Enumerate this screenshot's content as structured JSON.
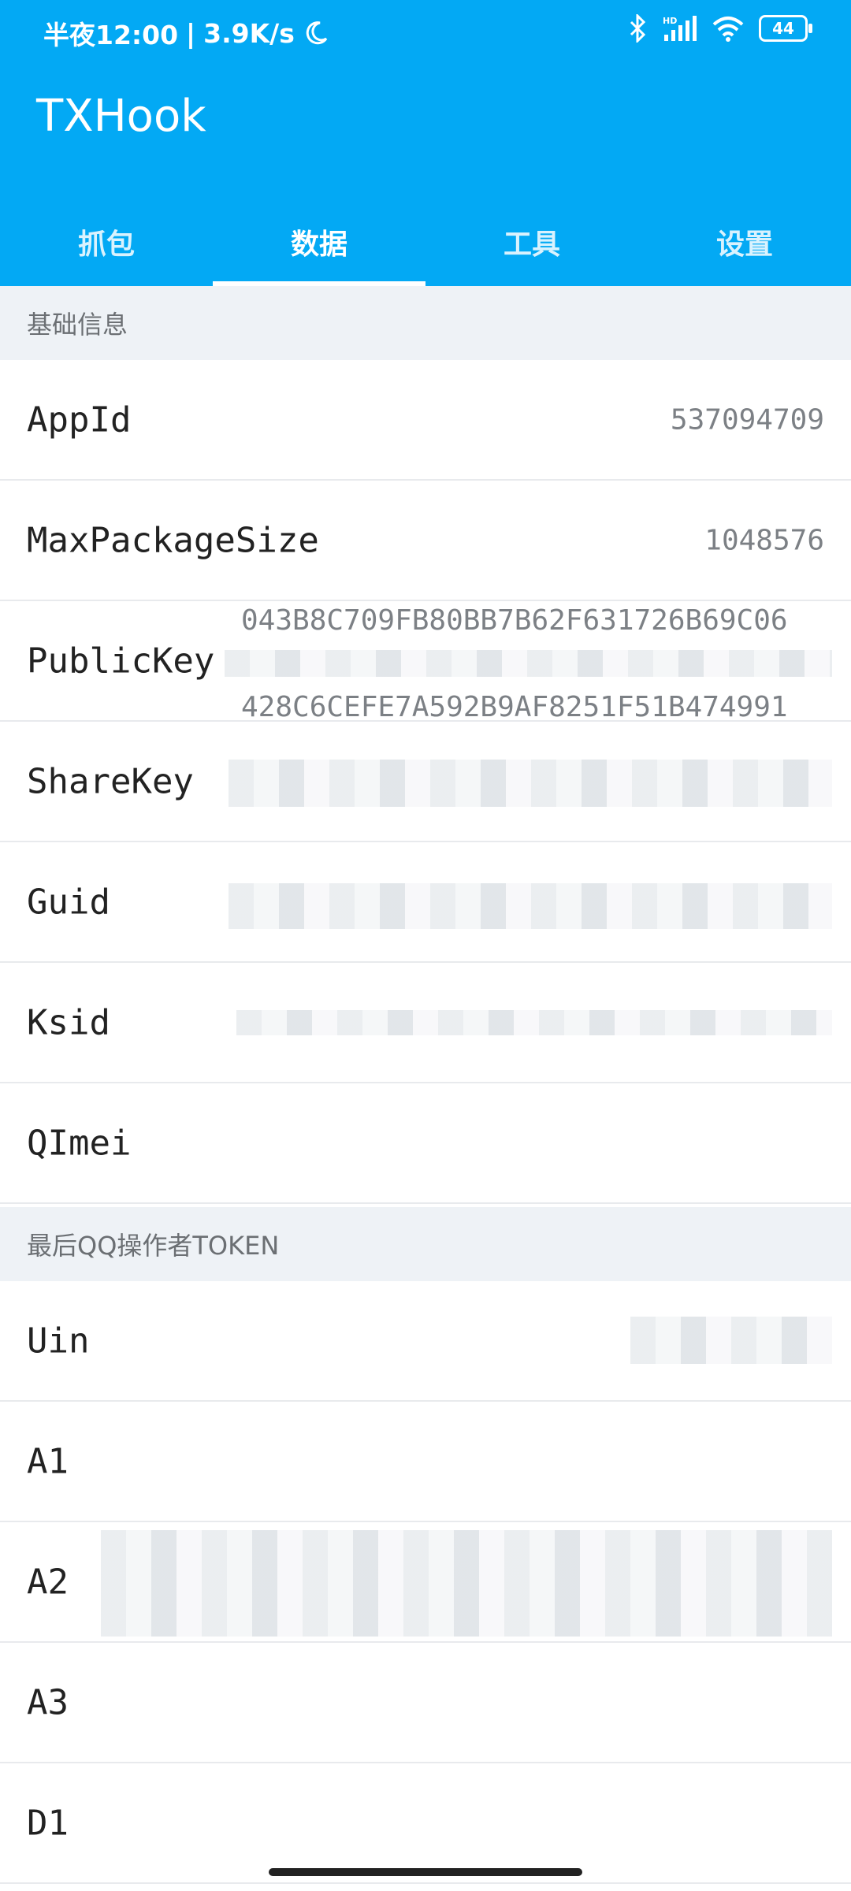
{
  "status_bar": {
    "time": "半夜12:00",
    "speed": "3.9K/s",
    "battery": "44",
    "icons": [
      "moon-icon",
      "bluetooth-icon",
      "signal-icon",
      "wifi-icon",
      "battery-icon"
    ],
    "hd_label": "HD"
  },
  "app": {
    "title": "TXHook"
  },
  "tabs": [
    {
      "label": "抓包"
    },
    {
      "label": "数据",
      "active": true
    },
    {
      "label": "工具"
    },
    {
      "label": "设置"
    }
  ],
  "sections": {
    "basic": "基础信息",
    "token": "最后QQ操作者TOKEN"
  },
  "rows": {
    "appid": {
      "label": "AppId",
      "value": "537094709"
    },
    "maxpackage": {
      "label": "MaxPackageSize",
      "value": "1048576"
    },
    "publickey": {
      "label": "PublicKey",
      "line1": "043B8C709FB80BB7B62F631726B69C06",
      "line3": "428C6CEFE7A592B9AF8251F51B474991"
    },
    "sharekey": {
      "label": "ShareKey"
    },
    "guid": {
      "label": "Guid"
    },
    "ksid": {
      "label": "Ksid"
    },
    "qimei": {
      "label": "QImei"
    },
    "uin": {
      "label": "Uin"
    },
    "a1": {
      "label": "A1"
    },
    "a2": {
      "label": "A2"
    },
    "a3": {
      "label": "A3"
    },
    "d1": {
      "label": "D1"
    }
  },
  "colors": {
    "accent": "#03a9f4",
    "section_bg": "#eef2f6"
  }
}
